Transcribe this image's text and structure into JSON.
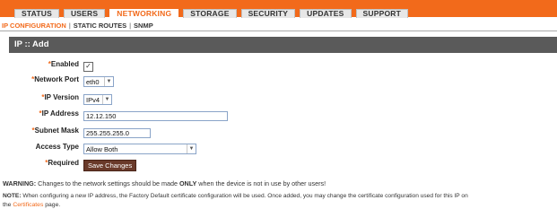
{
  "nav": {
    "tabs": [
      "STATUS",
      "USERS",
      "NETWORKING",
      "STORAGE",
      "SECURITY",
      "UPDATES",
      "SUPPORT"
    ],
    "active_tab": "NETWORKING",
    "subtabs": [
      "IP CONFIGURATION",
      "STATIC ROUTES",
      "SNMP"
    ],
    "active_subtab": "IP CONFIGURATION"
  },
  "panel": {
    "title": "IP :: Add"
  },
  "form": {
    "enabled": {
      "label": "Enabled",
      "checked": true,
      "check_glyph": "✓"
    },
    "network_port": {
      "label": "Network Port",
      "value": "eth0"
    },
    "ip_version": {
      "label": "IP Version",
      "value": "IPv4"
    },
    "ip_address": {
      "label": "IP Address",
      "value": "12.12.150"
    },
    "subnet_mask": {
      "label": "Subnet Mask",
      "value": "255.255.255.0"
    },
    "access_type": {
      "label": "Access Type",
      "value": "Allow Both"
    },
    "required": {
      "label": "Required"
    },
    "save_button": "Save Changes",
    "required_marker": "*"
  },
  "warning": {
    "prefix": "WARNING:",
    "text_before": " Changes to the network settings should be made ",
    "emphasis": "ONLY",
    "text_after": " when the device is not in use by other users!"
  },
  "note": {
    "prefix": "NOTE:",
    "line1": " When configuring a new IP address, the Factory Default certificate configuration will be used. Once added, you may change the certificate configuration used for this IP on",
    "line2_before": "the ",
    "link": "Certificates",
    "line2_after": " page."
  },
  "colors": {
    "accent": "#f26a1b",
    "header_bg": "#5a5a5a",
    "button_bg": "#6a3a2a"
  }
}
